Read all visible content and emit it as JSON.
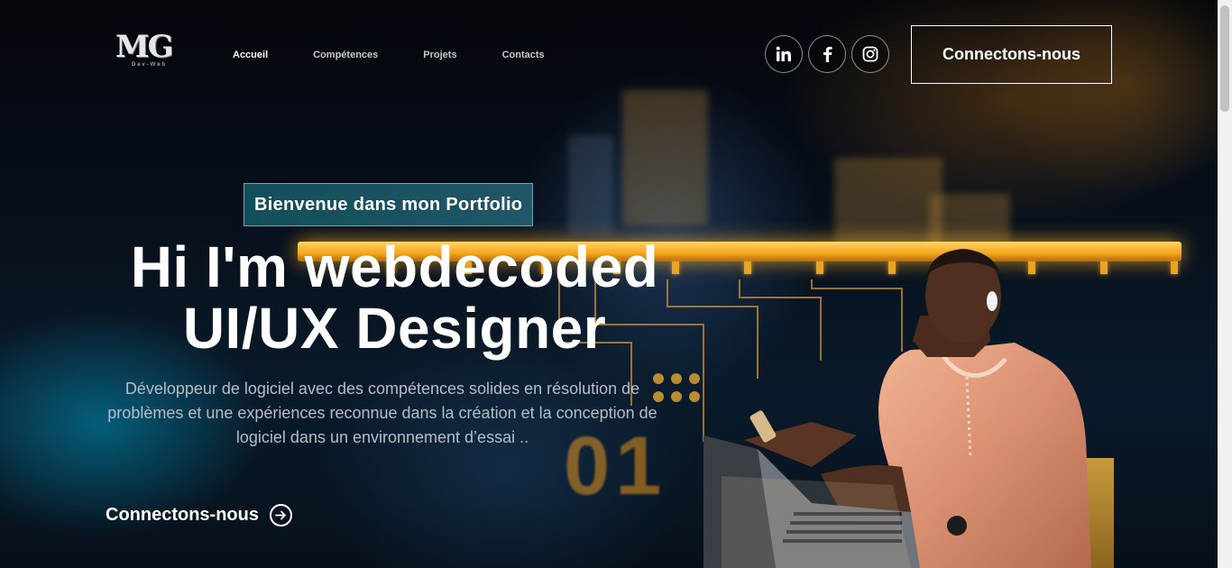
{
  "logo": {
    "mark": "MG",
    "tagline": "Dev-Web"
  },
  "nav": {
    "items": [
      {
        "label": "Accueil",
        "active": true
      },
      {
        "label": "Compétences",
        "active": false
      },
      {
        "label": "Projets",
        "active": false
      },
      {
        "label": "Contacts",
        "active": false
      }
    ]
  },
  "social": [
    "linkedin-icon",
    "facebook-icon",
    "instagram-icon"
  ],
  "header": {
    "connect_label": "Connectons-nous"
  },
  "hero": {
    "badge": "Bienvenue dans mon Portfolio",
    "title_line1": "Hi I'm webdecoded",
    "title_line2": "UI/UX Designer",
    "description": "Développeur de logiciel avec des compétences solides en résolution de problèmes et une expériences reconnue dans la création et la conception de logiciel dans un environnement d’essai ..",
    "cta_label": "Connectons-nous"
  },
  "colors": {
    "accent_gold": "#f4a51c",
    "badge_bg": "#1b6a74",
    "text_muted": "#b5bec8"
  }
}
